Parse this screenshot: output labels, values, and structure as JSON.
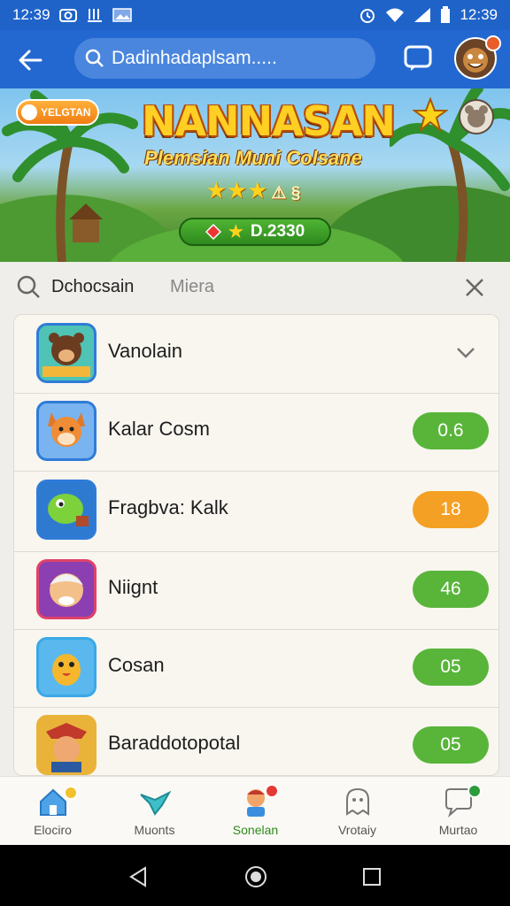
{
  "status_bar": {
    "time": "12:39",
    "left_icons": [
      "camera-icon",
      "download-icon",
      "image-icon"
    ],
    "right_icons": [
      "alarm-icon",
      "wifi-icon",
      "signal-icon",
      "battery-icon"
    ]
  },
  "app_bar": {
    "search_text": "Dadinhadaplsam.....",
    "icons": [
      "back-arrow-icon",
      "search-icon",
      "chat-icon",
      "avatar"
    ]
  },
  "banner": {
    "title": "NANNASAN",
    "subtitle": "Plemsian Muni Colsane",
    "stars_text": "★★★",
    "stars_suffix": "⚠ §",
    "pill_text": "D.2330",
    "badge_text": "YELGTAN",
    "close_label": "✕"
  },
  "filter": {
    "active": "Dchocsain",
    "other": "Miera"
  },
  "list": {
    "rows": [
      {
        "name": "Vanolain",
        "score": "",
        "kind": "dropdown"
      },
      {
        "name": "Kalar Cosm",
        "score": "0.6",
        "kind": "green"
      },
      {
        "name": "Fragbva: Kalk",
        "score": "18",
        "kind": "orange"
      },
      {
        "name": "Niignt",
        "score": "46",
        "kind": "green"
      },
      {
        "name": "Cosan",
        "score": "05",
        "kind": "green"
      },
      {
        "name": "Baraddotopotal",
        "score": "05",
        "kind": "green"
      }
    ]
  },
  "bottom_nav": {
    "items": [
      {
        "label": "Elociro",
        "icon": "home-icon"
      },
      {
        "label": "Muonts",
        "icon": "bird-icon"
      },
      {
        "label": "Sonelan",
        "icon": "character-icon"
      },
      {
        "label": "Vrotaiy",
        "icon": "ghost-icon"
      },
      {
        "label": "Murtao",
        "icon": "speech-icon"
      }
    ],
    "active_index": 2
  },
  "colors": {
    "app_bar": "#2368d1",
    "accent_green": "#59b53a",
    "accent_orange": "#f4a024"
  }
}
